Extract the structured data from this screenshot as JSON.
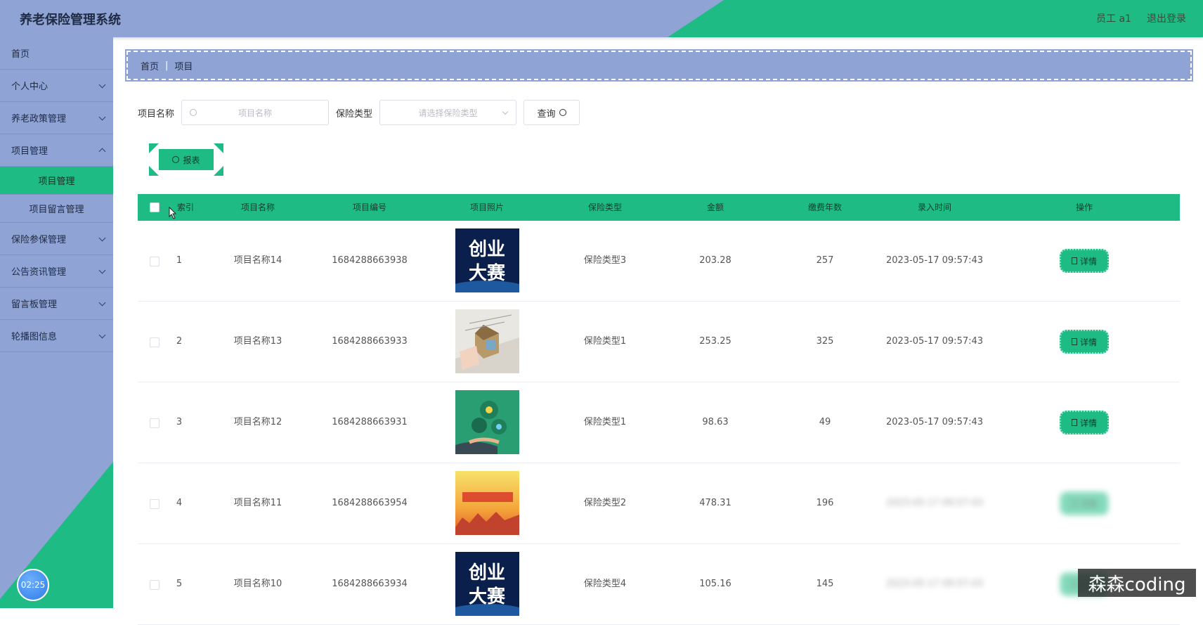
{
  "header": {
    "title": "养老保险管理系统",
    "user": "员工 a1",
    "logout": "退出登录"
  },
  "sidebar": {
    "items": [
      {
        "label": "首页"
      },
      {
        "label": "个人中心"
      },
      {
        "label": "养老政策管理"
      },
      {
        "label": "项目管理"
      },
      {
        "label": "保险参保管理"
      },
      {
        "label": "公告资讯管理"
      },
      {
        "label": "留言板管理"
      },
      {
        "label": "轮播图信息"
      }
    ],
    "sub_items": [
      {
        "label": "项目管理"
      },
      {
        "label": "项目留言管理"
      }
    ],
    "timer": "02:25"
  },
  "breadcrumb": {
    "home": "首页",
    "sep": "|",
    "current": "项目"
  },
  "search": {
    "name_label": "项目名称",
    "name_placeholder": "项目名称",
    "type_label": "保险类型",
    "type_placeholder": "请选择保险类型",
    "query_label": "查询"
  },
  "report_label": "报表",
  "table": {
    "headers": [
      "索引",
      "项目名称",
      "项目编号",
      "项目照片",
      "保险类型",
      "金额",
      "缴费年数",
      "录入时间",
      "操作"
    ],
    "detail_label": "详情",
    "rows": [
      {
        "index": "1",
        "name": "项目名称14",
        "code": "1684288663938",
        "photo": "创业大赛",
        "type": "保险类型3",
        "amount": "203.28",
        "years": "257",
        "time": "2023-05-17 09:57:43"
      },
      {
        "index": "2",
        "name": "项目名称13",
        "code": "1684288663933",
        "photo": "",
        "type": "保险类型1",
        "amount": "253.25",
        "years": "325",
        "time": "2023-05-17 09:57:43"
      },
      {
        "index": "3",
        "name": "项目名称12",
        "code": "1684288663931",
        "photo": "",
        "type": "保险类型1",
        "amount": "98.63",
        "years": "49",
        "time": "2023-05-17 09:57:43"
      },
      {
        "index": "4",
        "name": "项目名称11",
        "code": "1684288663954",
        "photo": "",
        "type": "保险类型2",
        "amount": "478.31",
        "years": "196",
        "time": "2023-05-17 09:57:43"
      },
      {
        "index": "5",
        "name": "项目名称10",
        "code": "1684288663934",
        "photo": "创业大赛",
        "type": "保险类型4",
        "amount": "105.16",
        "years": "145",
        "time": "2023-05-17 09:57:43"
      }
    ]
  },
  "watermark": "森森coding",
  "colors": {
    "primary_green": "#1fbb84",
    "sidebar_blue": "#8fa4d4"
  }
}
